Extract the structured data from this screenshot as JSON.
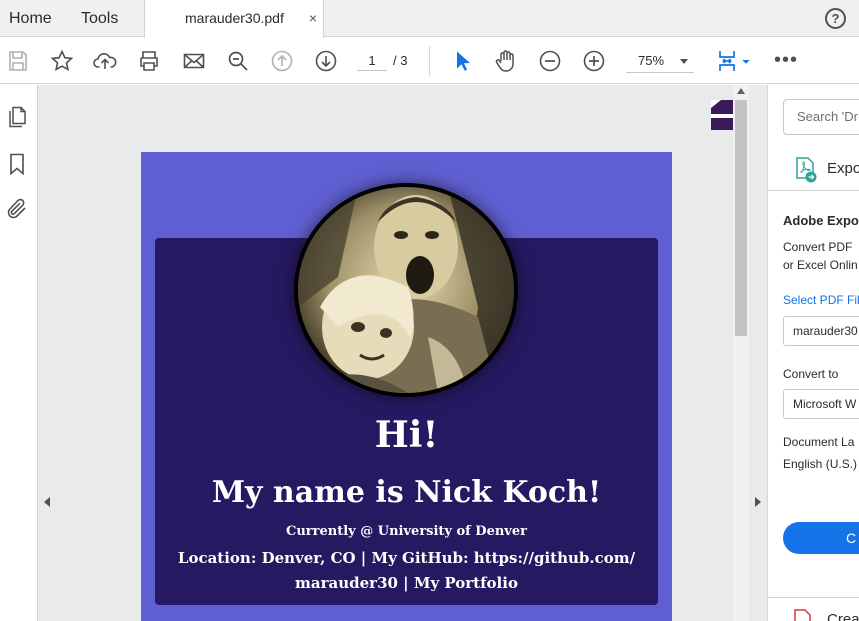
{
  "tabs": {
    "home": "Home",
    "tools": "Tools",
    "document": "marauder30.pdf",
    "close": "×",
    "help": "?"
  },
  "toolbar": {
    "icons": [
      "save-icon",
      "bookmark-star-icon",
      "upload-cloud-icon",
      "print-icon",
      "email-icon",
      "zoom-search-icon",
      "page-up-icon",
      "page-down-icon",
      "select-cursor-icon",
      "hand-tool-icon",
      "zoom-out-icon",
      "zoom-in-icon",
      "fit-page-icon",
      "more-icon"
    ],
    "page_current": "1",
    "page_total": "/ 3",
    "zoom": "75%",
    "more": "•••"
  },
  "left_nav": {
    "icons": [
      "page-thumbnails-icon",
      "bookmarks-icon",
      "attachments-icon"
    ]
  },
  "document": {
    "background_color": "#5f5fd1",
    "card_color": "#271961",
    "greeting": "Hi!",
    "name_line": "My name is Nick Koch!",
    "current_line": "Currently @ University of Denver",
    "location_line_1": "Location: Denver, CO | My GitHub: https://github.com/",
    "location_line_2": "marauder30 | My Portfolio"
  },
  "right_panel": {
    "search_placeholder": "Search 'Dr",
    "export_label": "Expo",
    "heading": "Adobe Expo",
    "desc_line_1": "Convert PDF",
    "desc_line_2": "or Excel Onlin",
    "select_link": "Select PDF Fil",
    "file_value": "marauder30",
    "convert_to_label": "Convert to",
    "convert_to_value": "Microsoft W",
    "doc_lang_label": "Document La",
    "doc_lang_value": "English (U.S.)",
    "convert_button": "C",
    "create_label": "Crea"
  },
  "colors": {
    "accent": "#1473e6",
    "toolbar_icon": "#505050",
    "select_tool_active": "#1473e6"
  }
}
